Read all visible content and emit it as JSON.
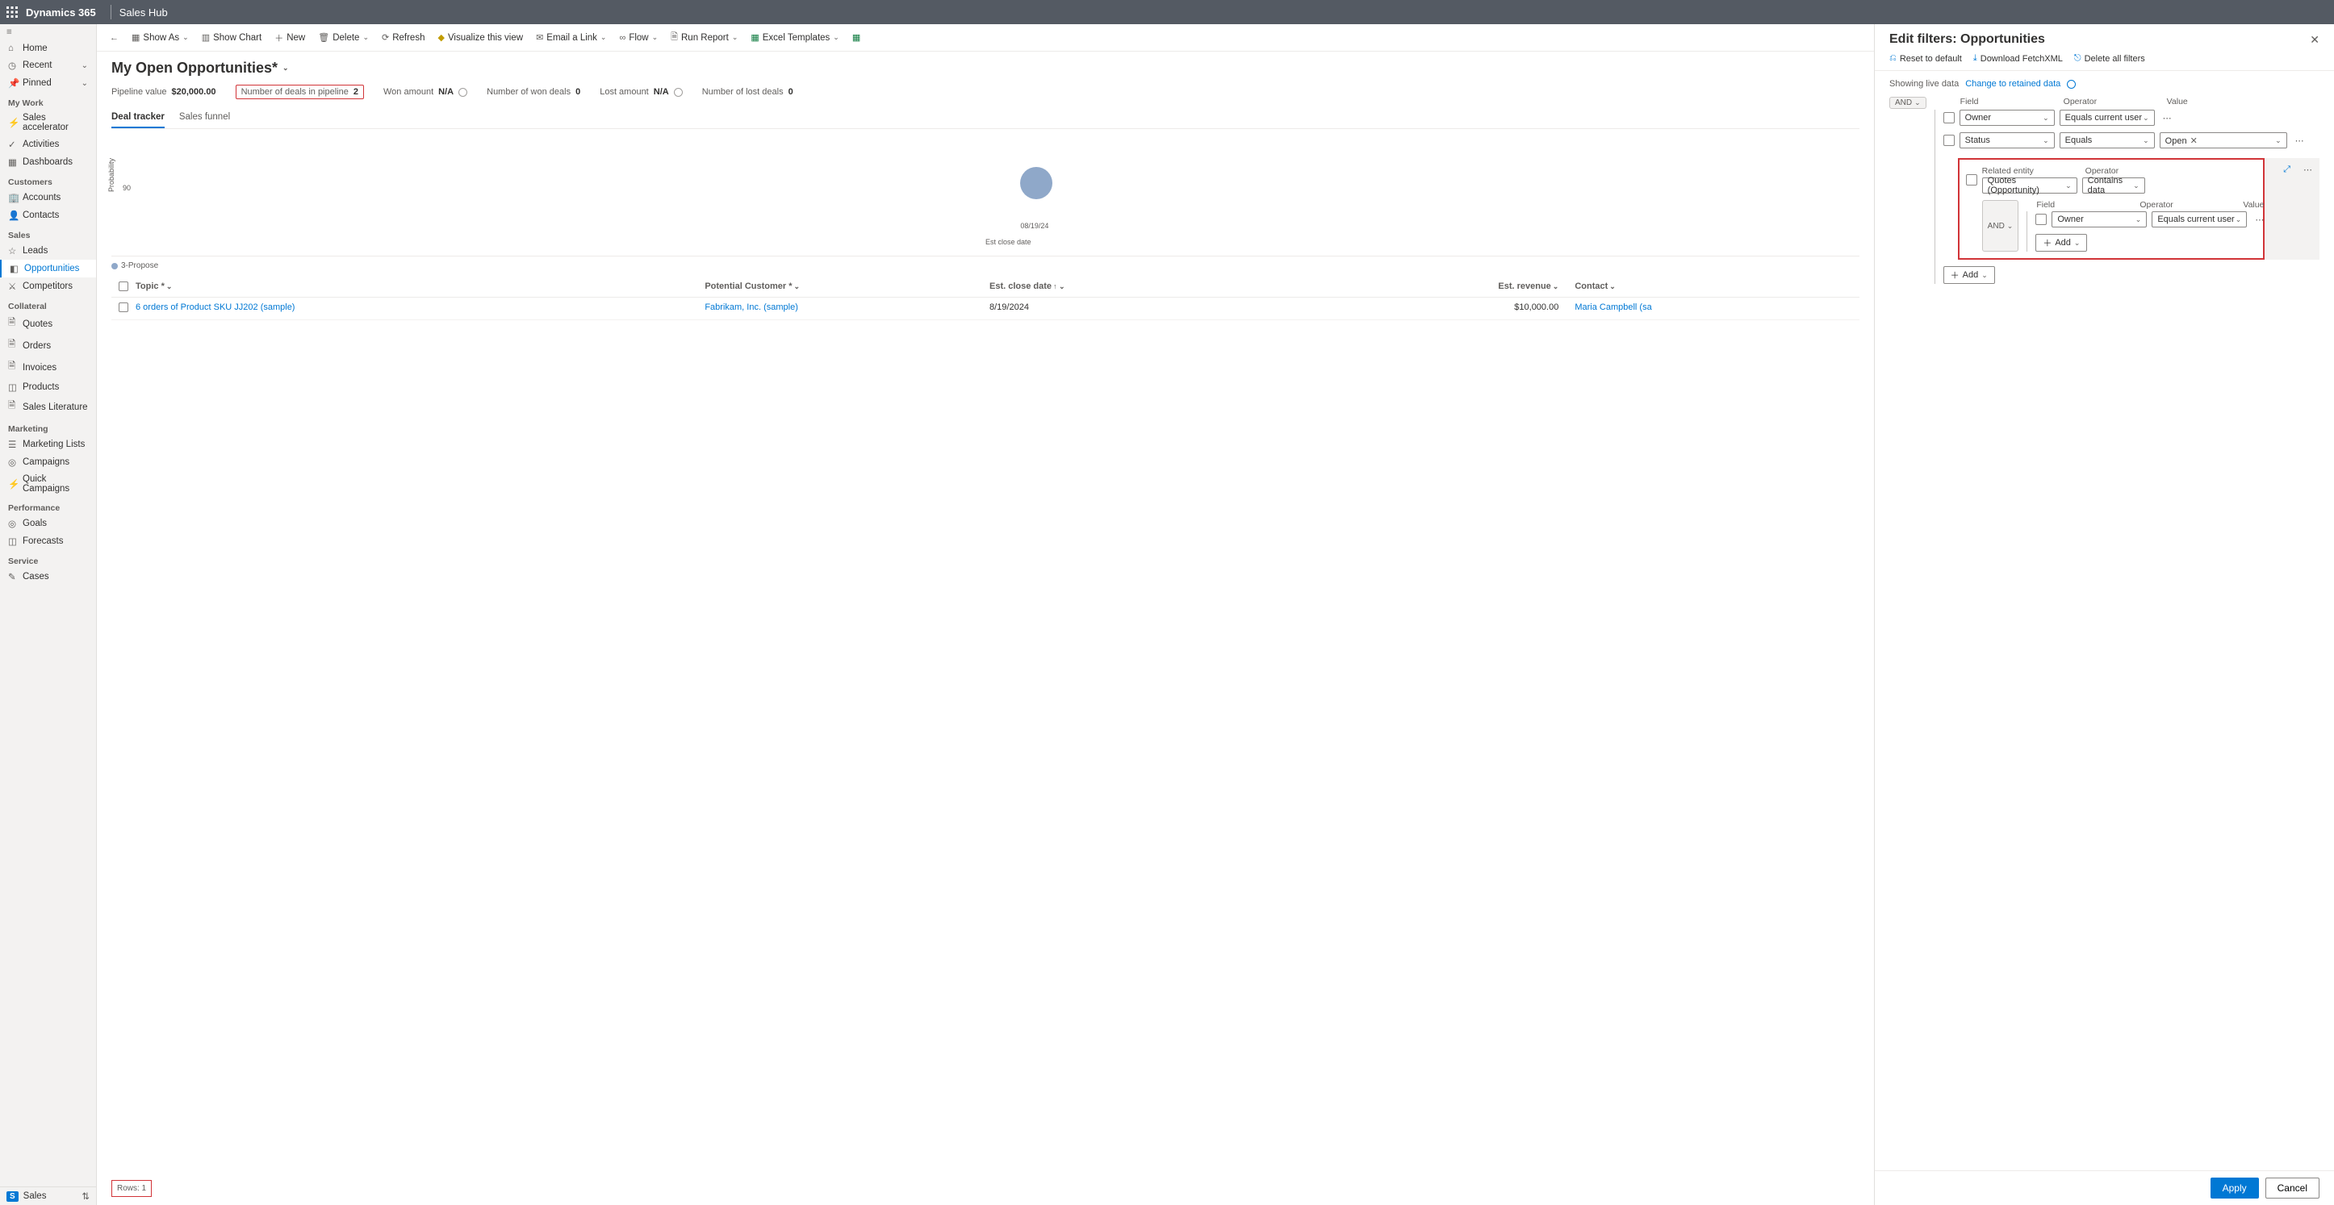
{
  "topbar": {
    "brand": "Dynamics 365",
    "app": "Sales Hub"
  },
  "nav": {
    "home": "Home",
    "recent": "Recent",
    "pinned": "Pinned",
    "mywork_hdr": "My Work",
    "sales_accel": "Sales accelerator",
    "activities": "Activities",
    "dashboards": "Dashboards",
    "customers_hdr": "Customers",
    "accounts": "Accounts",
    "contacts": "Contacts",
    "sales_hdr": "Sales",
    "leads": "Leads",
    "opportunities": "Opportunities",
    "competitors": "Competitors",
    "collateral_hdr": "Collateral",
    "quotes": "Quotes",
    "orders": "Orders",
    "invoices": "Invoices",
    "products": "Products",
    "sales_lit": "Sales Literature",
    "marketing_hdr": "Marketing",
    "mkt_lists": "Marketing Lists",
    "campaigns": "Campaigns",
    "quick_campaigns": "Quick Campaigns",
    "performance_hdr": "Performance",
    "goals": "Goals",
    "forecasts": "Forecasts",
    "service_hdr": "Service",
    "cases": "Cases",
    "footer_badge": "S",
    "footer_label": "Sales"
  },
  "cmdbar": {
    "show_as": "Show As",
    "show_chart": "Show Chart",
    "new": "New",
    "delete": "Delete",
    "refresh": "Refresh",
    "visualize": "Visualize this view",
    "email_link": "Email a Link",
    "flow": "Flow",
    "run_report": "Run Report",
    "excel_templates": "Excel Templates"
  },
  "view": {
    "title": "My Open Opportunities*",
    "metrics": {
      "pipeline_value_label": "Pipeline value",
      "pipeline_value": "$20,000.00",
      "deals_label": "Number of deals in pipeline",
      "deals": "2",
      "won_amount_label": "Won amount",
      "won_amount": "N/A",
      "won_deals_label": "Number of won deals",
      "won_deals": "0",
      "lost_amount_label": "Lost amount",
      "lost_amount": "N/A",
      "lost_deals_label": "Number of lost deals",
      "lost_deals": "0"
    },
    "tabs": {
      "deal_tracker": "Deal tracker",
      "sales_funnel": "Sales funnel"
    }
  },
  "chart_data": {
    "type": "scatter",
    "xlabel": "Est close date",
    "ylabel": "Probability",
    "x": [
      "08/19/24"
    ],
    "y": [
      90
    ],
    "series": [
      {
        "name": "3-Propose",
        "values": [
          {
            "x": "08/19/24",
            "y": 90
          }
        ]
      }
    ],
    "ylim": [
      0,
      100
    ]
  },
  "chart": {
    "ylabel": "Probability",
    "ytick": "90",
    "xtick": "08/19/24",
    "xlabel": "Est close date",
    "legend": "3-Propose"
  },
  "grid": {
    "cols": {
      "topic": "Topic *",
      "cust": "Potential Customer *",
      "date": "Est. close date",
      "rev": "Est. revenue",
      "contact": "Contact"
    },
    "row": {
      "topic": "6 orders of Product SKU JJ202 (sample)",
      "cust": "Fabrikam, Inc. (sample)",
      "date": "8/19/2024",
      "rev": "$10,000.00",
      "contact": "Maria Campbell (sa"
    },
    "footer": "Rows: 1"
  },
  "panel": {
    "title": "Edit filters: Opportunities",
    "reset": "Reset to default",
    "download": "Download FetchXML",
    "delete_all": "Delete all filters",
    "live_note": "Showing live data",
    "change_link": "Change to retained data",
    "and": "AND",
    "field_hdr": "Field",
    "op_hdr": "Operator",
    "val_hdr": "Value",
    "f1_field": "Owner",
    "f1_op": "Equals current user",
    "f2_field": "Status",
    "f2_op": "Equals",
    "f2_val": "Open",
    "rel_label": "Related entity",
    "rel_op_label": "Operator",
    "rel_entity": "Quotes (Opportunity)",
    "rel_op": "Contains data",
    "inner_field_hdr": "Field",
    "inner_op_hdr": "Operator",
    "inner_val_hdr": "Value",
    "inner_and": "AND",
    "inner_f_field": "Owner",
    "inner_f_op": "Equals current user",
    "add": "Add",
    "apply": "Apply",
    "cancel": "Cancel"
  }
}
